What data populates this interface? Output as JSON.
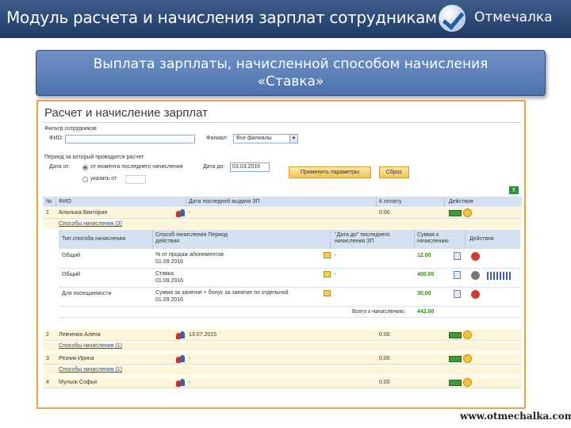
{
  "topbar": {
    "title": "Модуль расчета и начисления зарплат сотрудникам",
    "brand": "Отмечалка",
    "check_icon": "checkmark-icon"
  },
  "banner": {
    "line1": "Выплата зарплаты, начисленной способом начисления",
    "line2": "«Ставка»"
  },
  "app": {
    "title": "Расчет и начисление зарплат",
    "filter_label": "Фильтр сотрудников",
    "fio_label": "ФИО:",
    "branch_label": "Филиал:",
    "branch_value": "Все филиалы",
    "period_label": "Период за который проводится расчет",
    "date_from_label": "Дата от:",
    "radio1": "от момента последнего начисления",
    "radio2": "указать от",
    "date_to_label": "Дата до:",
    "date_to_value": "03.03.2016",
    "apply_button": "Применить параметры",
    "reset_button": "Сброс"
  },
  "table": {
    "headers": [
      "№",
      "ФИО",
      "Дата последней выдачи ЗП",
      "К оплату",
      "Действия"
    ],
    "rows": [
      {
        "num": "1",
        "name": "Алалыка Виктория",
        "date": "-",
        "amount": "0.00",
        "sub": "Способы начисления (3)"
      },
      {
        "num": "2",
        "name": "Левченко Алена",
        "date": "13.07.2015",
        "amount": "0.00",
        "sub": "Способы начисления (1)"
      },
      {
        "num": "3",
        "name": "Резник Ирина",
        "date": "-",
        "amount": "0.00",
        "sub": "Способы начисления (1)"
      },
      {
        "num": "4",
        "name": "Мульок Софья",
        "date": "-",
        "amount": "0.00",
        "sub": ""
      }
    ],
    "inner_headers": [
      "Тип способа начисления",
      "Способ начисления Период действия",
      "\"Дата до\" последнего начисления ЗП",
      "Сумма к начислению",
      "Действия"
    ],
    "inner_rows": [
      {
        "type": "Общий",
        "method": "% от продаж абонементов",
        "period": "01.09.2016",
        "last": "-",
        "sum": "12.00"
      },
      {
        "type": "Общий",
        "method": "Ставка",
        "period": "01.09.2016",
        "last": "-",
        "sum": "400.00"
      },
      {
        "type": "Для посещаемости",
        "method": "Сумма за занятие + бонус за занятие по отдельной",
        "period": "01.09.2016",
        "last": "",
        "sum": "30.00"
      }
    ],
    "total_label": "Всего к начислению:",
    "total_value": "442.00"
  },
  "footer": {
    "url": "www.otmechalka.com"
  }
}
